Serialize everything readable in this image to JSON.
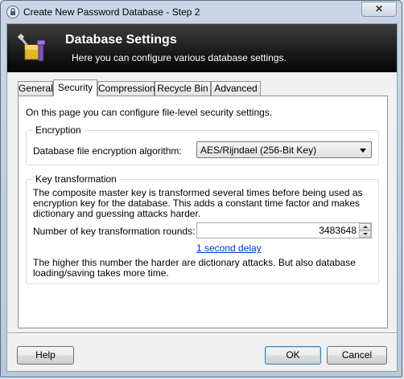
{
  "window": {
    "title": "Create New Password Database - Step 2",
    "close_glyph": "✕"
  },
  "banner": {
    "title": "Database Settings",
    "subtitle": "Here you can configure various database settings.",
    "icon": "database-settings-icon"
  },
  "tabs": [
    {
      "label": "General",
      "active": false
    },
    {
      "label": "Security",
      "active": true
    },
    {
      "label": "Compression",
      "active": false
    },
    {
      "label": "Recycle Bin",
      "active": false
    },
    {
      "label": "Advanced",
      "active": false
    }
  ],
  "security": {
    "intro": "On this page you can configure file-level security settings.",
    "encryption": {
      "group_label": "Encryption",
      "algorithm_label": "Database file encryption algorithm:",
      "algorithm_value": "AES/Rijndael (256-Bit Key)"
    },
    "key_transformation": {
      "group_label": "Key transformation",
      "description": "The composite master key is transformed several times before being used as encryption key for the database. This adds a constant time factor and makes dictionary and guessing attacks harder.",
      "rounds_label": "Number of key transformation rounds:",
      "rounds_value": "3483648",
      "delay_link": "1 second delay",
      "note": "The higher this number the harder are dictionary attacks. But also database loading/saving takes more time."
    }
  },
  "buttons": {
    "help": "Help",
    "ok": "OK",
    "cancel": "Cancel"
  }
}
